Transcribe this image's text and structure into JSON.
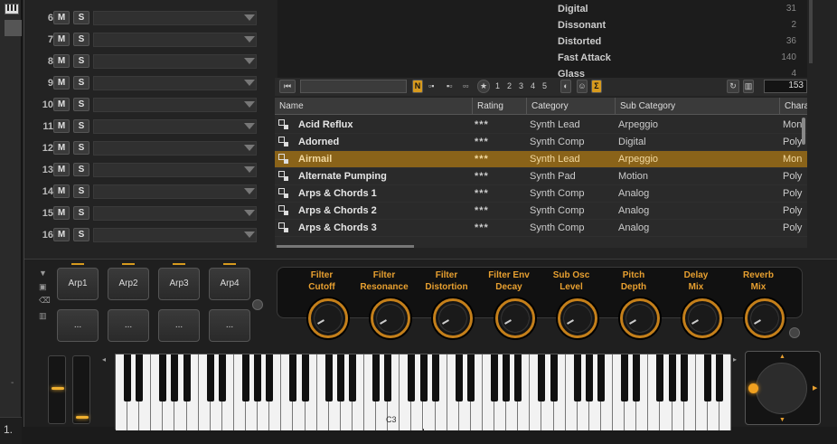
{
  "slots": [
    {
      "num": "6"
    },
    {
      "num": "7"
    },
    {
      "num": "8"
    },
    {
      "num": "9"
    },
    {
      "num": "10"
    },
    {
      "num": "11"
    },
    {
      "num": "12"
    },
    {
      "num": "13"
    },
    {
      "num": "14"
    },
    {
      "num": "15"
    },
    {
      "num": "16"
    }
  ],
  "slot_buttons": {
    "m": "M",
    "s": "S"
  },
  "attributes": [
    {
      "name": "Digital",
      "count": "31"
    },
    {
      "name": "Dissonant",
      "count": "2"
    },
    {
      "name": "Distorted",
      "count": "36"
    },
    {
      "name": "Fast Attack",
      "count": "140"
    },
    {
      "name": "Glass",
      "count": "4"
    }
  ],
  "toolbar": {
    "n_label": "N",
    "ratings": [
      "1",
      "2",
      "3",
      "4",
      "5"
    ],
    "sigma": "Σ",
    "result_count": "153"
  },
  "table": {
    "columns": [
      "Name",
      "Rating",
      "Category",
      "Sub Category",
      "Chara"
    ],
    "rows": [
      {
        "name": "Acid Reflux",
        "rating": "***",
        "category": "Synth Lead",
        "sub": "Arpeggio",
        "char": "Mon"
      },
      {
        "name": "Adorned",
        "rating": "***",
        "category": "Synth Comp",
        "sub": "Digital",
        "char": "Poly"
      },
      {
        "name": "Airmail",
        "rating": "***",
        "category": "Synth Lead",
        "sub": "Arpeggio",
        "char": "Mon",
        "selected": true
      },
      {
        "name": "Alternate Pumping",
        "rating": "***",
        "category": "Synth Pad",
        "sub": "Motion",
        "char": "Poly"
      },
      {
        "name": "Arps & Chords 1",
        "rating": "***",
        "category": "Synth Comp",
        "sub": "Analog",
        "char": "Poly"
      },
      {
        "name": "Arps & Chords 2",
        "rating": "***",
        "category": "Synth Comp",
        "sub": "Analog",
        "char": "Poly"
      },
      {
        "name": "Arps & Chords 3",
        "rating": "***",
        "category": "Synth Comp",
        "sub": "Analog",
        "char": "Poly"
      }
    ]
  },
  "arp_buttons": [
    "Arp1",
    "Arp2",
    "Arp3",
    "Arp4"
  ],
  "arp_empty": [
    "...",
    "...",
    "...",
    "..."
  ],
  "quick_controls": [
    {
      "l1": "Filter",
      "l2": "Cutoff"
    },
    {
      "l1": "Filter",
      "l2": "Resonance"
    },
    {
      "l1": "Filter",
      "l2": "Distortion"
    },
    {
      "l1": "Filter Env",
      "l2": "Decay"
    },
    {
      "l1": "Sub Osc",
      "l2": "Level"
    },
    {
      "l1": "Pitch",
      "l2": "Depth"
    },
    {
      "l1": "Delay",
      "l2": "Mix"
    },
    {
      "l1": "Reverb",
      "l2": "Mix"
    }
  ],
  "keyboard": {
    "c3_label": "C3"
  },
  "left_strip": {
    "bottom_text": "1.",
    "dash": "-"
  },
  "colors": {
    "accent": "#d79a1e",
    "selected_row": "#8a6319"
  }
}
